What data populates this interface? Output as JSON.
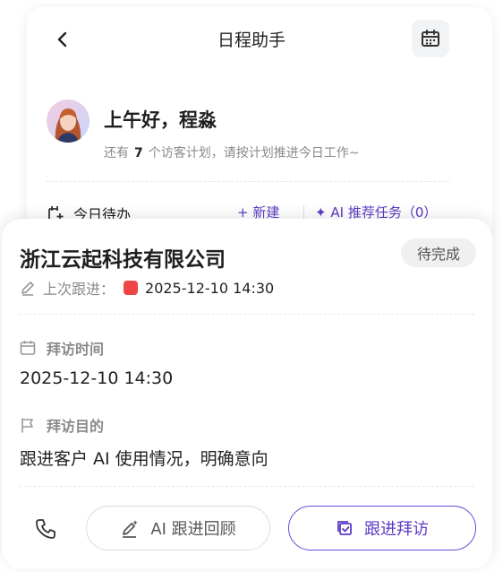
{
  "header": {
    "title": "日程助手",
    "back_icon": "chevron-left-icon",
    "calendar_icon": "calendar-icon"
  },
  "greeting": {
    "title": "上午好，程淼",
    "sub_prefix": "还有",
    "count": "7",
    "sub_suffix": "个访客计划，请按计划推进今日工作~"
  },
  "todo": {
    "title": "今日待办",
    "new_label": "+ 新建",
    "ai_label": "AI 推荐任务（0）"
  },
  "card": {
    "company": "浙江云起科技有限公司",
    "status": "待完成",
    "last_label": "上次跟进：",
    "last_datetime": "2025-12-10 14:30",
    "visit_time_label": "拜访时间",
    "visit_time": "2025-12-10 14:30",
    "purpose_label": "拜访目的",
    "purpose": "跟进客户 AI 使用情况，明确意向",
    "review_button": "AI 跟进回顾",
    "visit_button": "跟进拜访"
  },
  "colors": {
    "accent": "#5b3cc4",
    "status_red": "#f04545"
  }
}
